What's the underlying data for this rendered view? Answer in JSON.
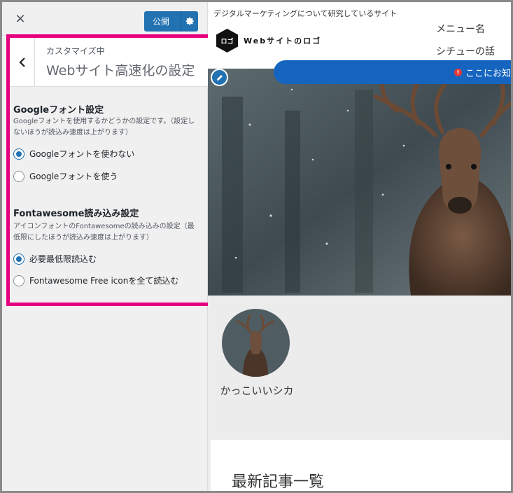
{
  "customizer": {
    "close_label": "×",
    "publish_label": "公開",
    "breadcrumb": "カスタマイズ中",
    "section_title": "Webサイト高速化の設定",
    "settings": [
      {
        "title": "Googleフォント設定",
        "description": "Googleフォントを使用するかどうかの設定です。（設定しないほうが読込み速度は上がります）",
        "options": [
          {
            "label": "Googleフォントを使わない",
            "checked": true
          },
          {
            "label": "Googleフォントを使う",
            "checked": false
          }
        ]
      },
      {
        "title": "Fontawesome読み込み設定",
        "description": "アイコンフォントのFontawesomeの読み込みの設定（最低限にしたほうが読込み速度は上がります）",
        "options": [
          {
            "label": "必要最低限読込む",
            "checked": true
          },
          {
            "label": "Fontawesome Free iconを全て読込む",
            "checked": false
          }
        ]
      }
    ]
  },
  "preview": {
    "tagline": "デジタルマーケティングについて研究しているサイト",
    "logo_mark": "ロゴ",
    "logo_text": "Webサイトのロゴ",
    "menu": [
      "メニュー名",
      "シチューの話"
    ],
    "notice_text": "ここにお知",
    "author_name": "かっこいいシカ",
    "posts_heading": "最新記事一覧"
  },
  "colors": {
    "accent": "#2271b1",
    "highlight": "#e6007e",
    "notice": "#1565c0"
  }
}
